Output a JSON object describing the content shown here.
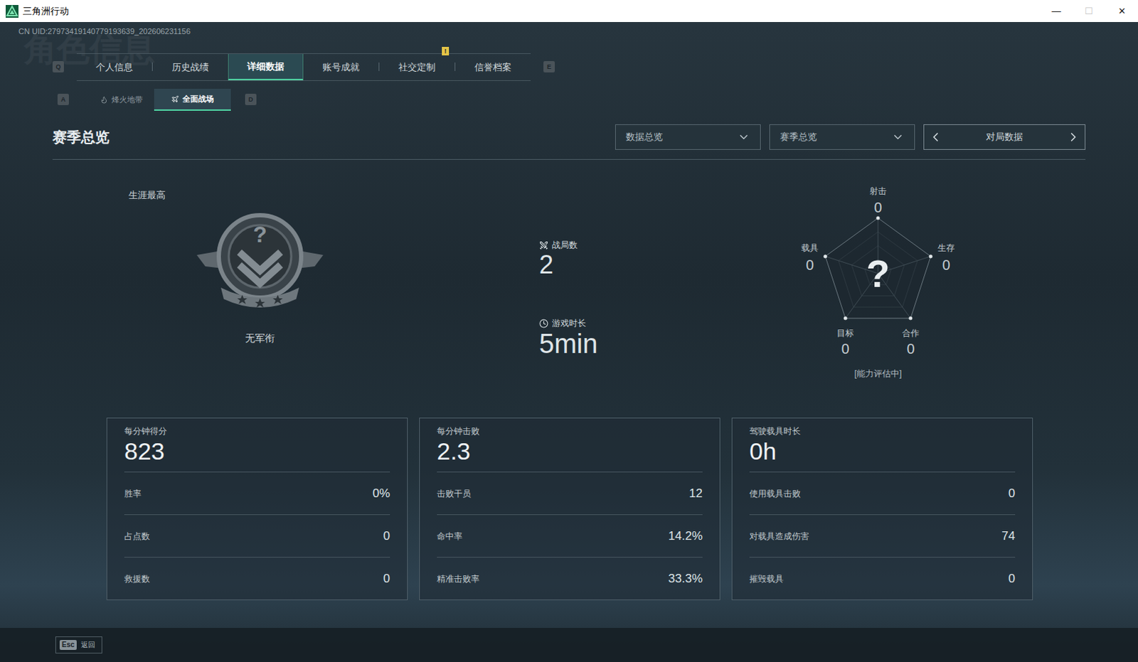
{
  "window": {
    "title": "三角洲行动",
    "controls": [
      {
        "glyph": "—",
        "disabled": false
      },
      {
        "glyph": "☐",
        "disabled": true
      },
      {
        "glyph": "✕",
        "disabled": false
      }
    ]
  },
  "uid": "CN UID:27973419140779193639_202606231156",
  "watermark": "角色信息",
  "tabs": {
    "prev_key": "Q",
    "next_key": "E",
    "items": [
      {
        "label": "个人信息",
        "selected": false
      },
      {
        "label": "历史战绩",
        "selected": false
      },
      {
        "label": "详细数据",
        "selected": true
      },
      {
        "label": "账号成就",
        "selected": false
      },
      {
        "label": "社交定制",
        "selected": false,
        "badge": "!"
      },
      {
        "label": "信誉档案",
        "selected": false
      }
    ]
  },
  "mode_tabs": {
    "prev_key": "A",
    "next_key": "D",
    "items": [
      {
        "label": "烽火地带",
        "selected": false
      },
      {
        "label": "全面战场",
        "selected": true
      }
    ]
  },
  "section_title": "赛季总览",
  "filters": [
    {
      "label": "数据总览"
    },
    {
      "label": "赛季总览"
    }
  ],
  "pager": {
    "label": "对局数据"
  },
  "rank": {
    "caption": "生涯最高",
    "mark": "?",
    "name": "无军衔"
  },
  "summary": [
    {
      "label": "战局数",
      "value": "2"
    },
    {
      "label": "游戏时长",
      "value": "5min"
    }
  ],
  "radar": {
    "center": "?",
    "status": "[能力评估中]",
    "axes": [
      {
        "label": "射击",
        "value": "0",
        "level": 0
      },
      {
        "label": "生存",
        "value": "0",
        "level": 0
      },
      {
        "label": "合作",
        "value": "0",
        "level": 0
      },
      {
        "label": "目标",
        "value": "0",
        "level": 0
      },
      {
        "label": "载具",
        "value": "0",
        "level": 0
      }
    ]
  },
  "cards": [
    {
      "title": "每分钟得分",
      "value": "823",
      "rows": [
        {
          "label": "胜率",
          "value": "0%"
        },
        {
          "label": "占点数",
          "value": "0"
        },
        {
          "label": "救援数",
          "value": "0"
        }
      ]
    },
    {
      "title": "每分钟击败",
      "value": "2.3",
      "rows": [
        {
          "label": "击败干员",
          "value": "12"
        },
        {
          "label": "命中率",
          "value": "14.2%"
        },
        {
          "label": "精准击败率",
          "value": "33.3%"
        }
      ]
    },
    {
      "title": "驾驶载具时长",
      "value": "0h",
      "rows": [
        {
          "label": "使用载具击败",
          "value": "0"
        },
        {
          "label": "对载具造成伤害",
          "value": "74"
        },
        {
          "label": "摧毁载具",
          "value": "0"
        }
      ]
    }
  ],
  "footer": {
    "key": "Esc",
    "label": "返回"
  }
}
